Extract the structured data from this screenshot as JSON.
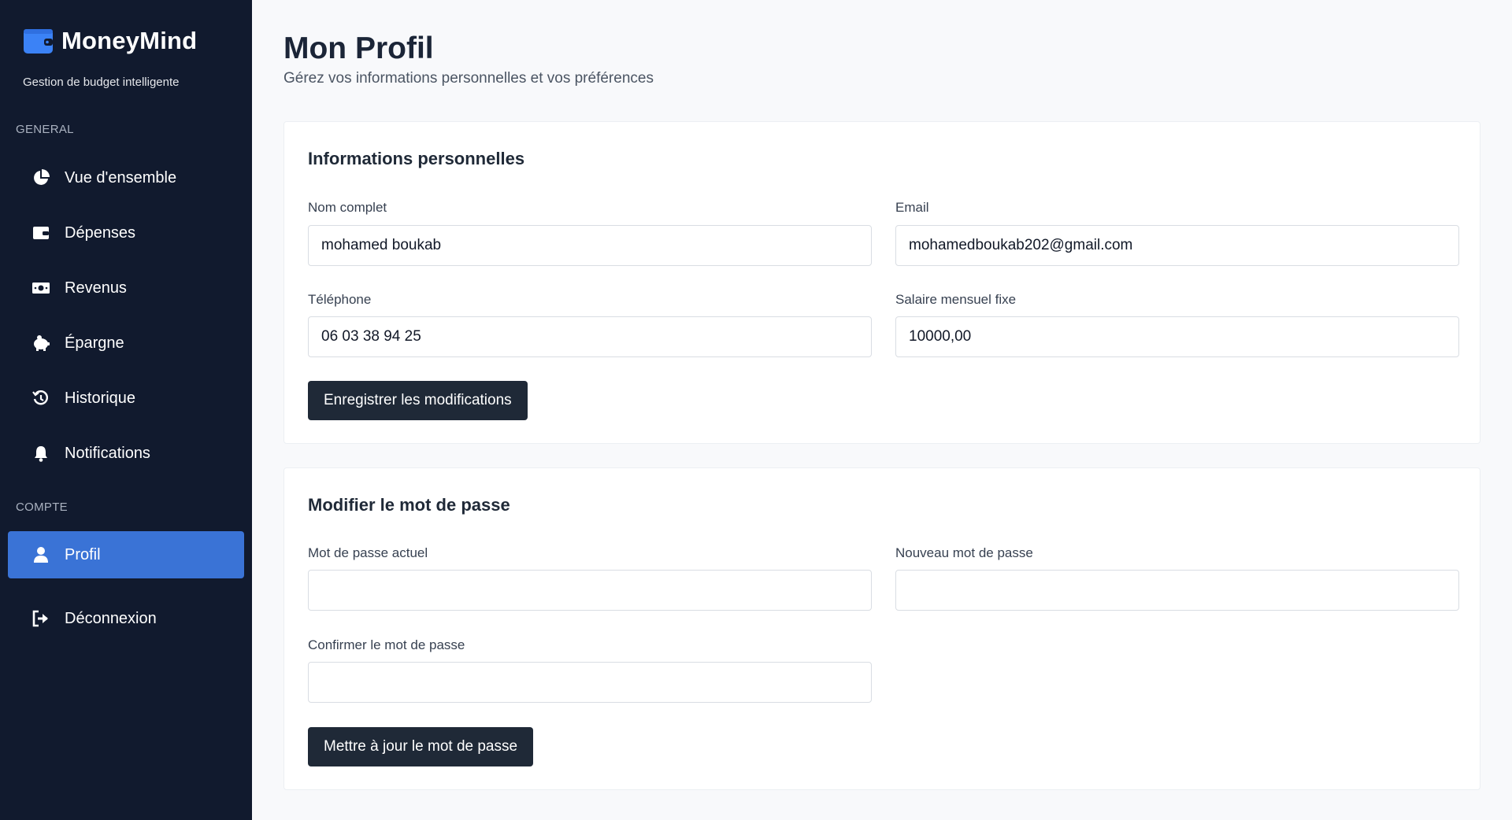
{
  "app": {
    "name": "MoneyMind",
    "tagline": "Gestion de budget intelligente",
    "brand_color": "#3b82f6"
  },
  "sidebar": {
    "general_label": "GENERAL",
    "account_label": "COMPTE",
    "items": [
      {
        "label": "Vue d'ensemble",
        "icon": "pie-chart-icon"
      },
      {
        "label": "Dépenses",
        "icon": "wallet-icon"
      },
      {
        "label": "Revenus",
        "icon": "money-bill-icon"
      },
      {
        "label": "Épargne",
        "icon": "piggy-bank-icon"
      },
      {
        "label": "Historique",
        "icon": "history-icon"
      },
      {
        "label": "Notifications",
        "icon": "bell-icon"
      }
    ],
    "account_items": [
      {
        "label": "Profil",
        "icon": "user-icon",
        "active": true
      },
      {
        "label": "Déconnexion",
        "icon": "logout-icon"
      }
    ],
    "active_color": "#3a73d6"
  },
  "page": {
    "title": "Mon Profil",
    "subtitle": "Gérez vos informations personnelles et vos préférences"
  },
  "personal_info": {
    "title": "Informations personnelles",
    "full_name_label": "Nom complet",
    "full_name_value": "mohamed boukab",
    "email_label": "Email",
    "email_value": "mohamedboukab202@gmail.com",
    "phone_label": "Téléphone",
    "phone_value": "06 03 38 94 25",
    "salary_label": "Salaire mensuel fixe",
    "salary_value": "10000,00",
    "save_button": "Enregistrer les modifications"
  },
  "password": {
    "title": "Modifier le mot de passe",
    "current_label": "Mot de passe actuel",
    "current_value": "",
    "new_label": "Nouveau mot de passe",
    "new_value": "",
    "confirm_label": "Confirmer le mot de passe",
    "confirm_value": "",
    "update_button": "Mettre à jour le mot de passe"
  }
}
